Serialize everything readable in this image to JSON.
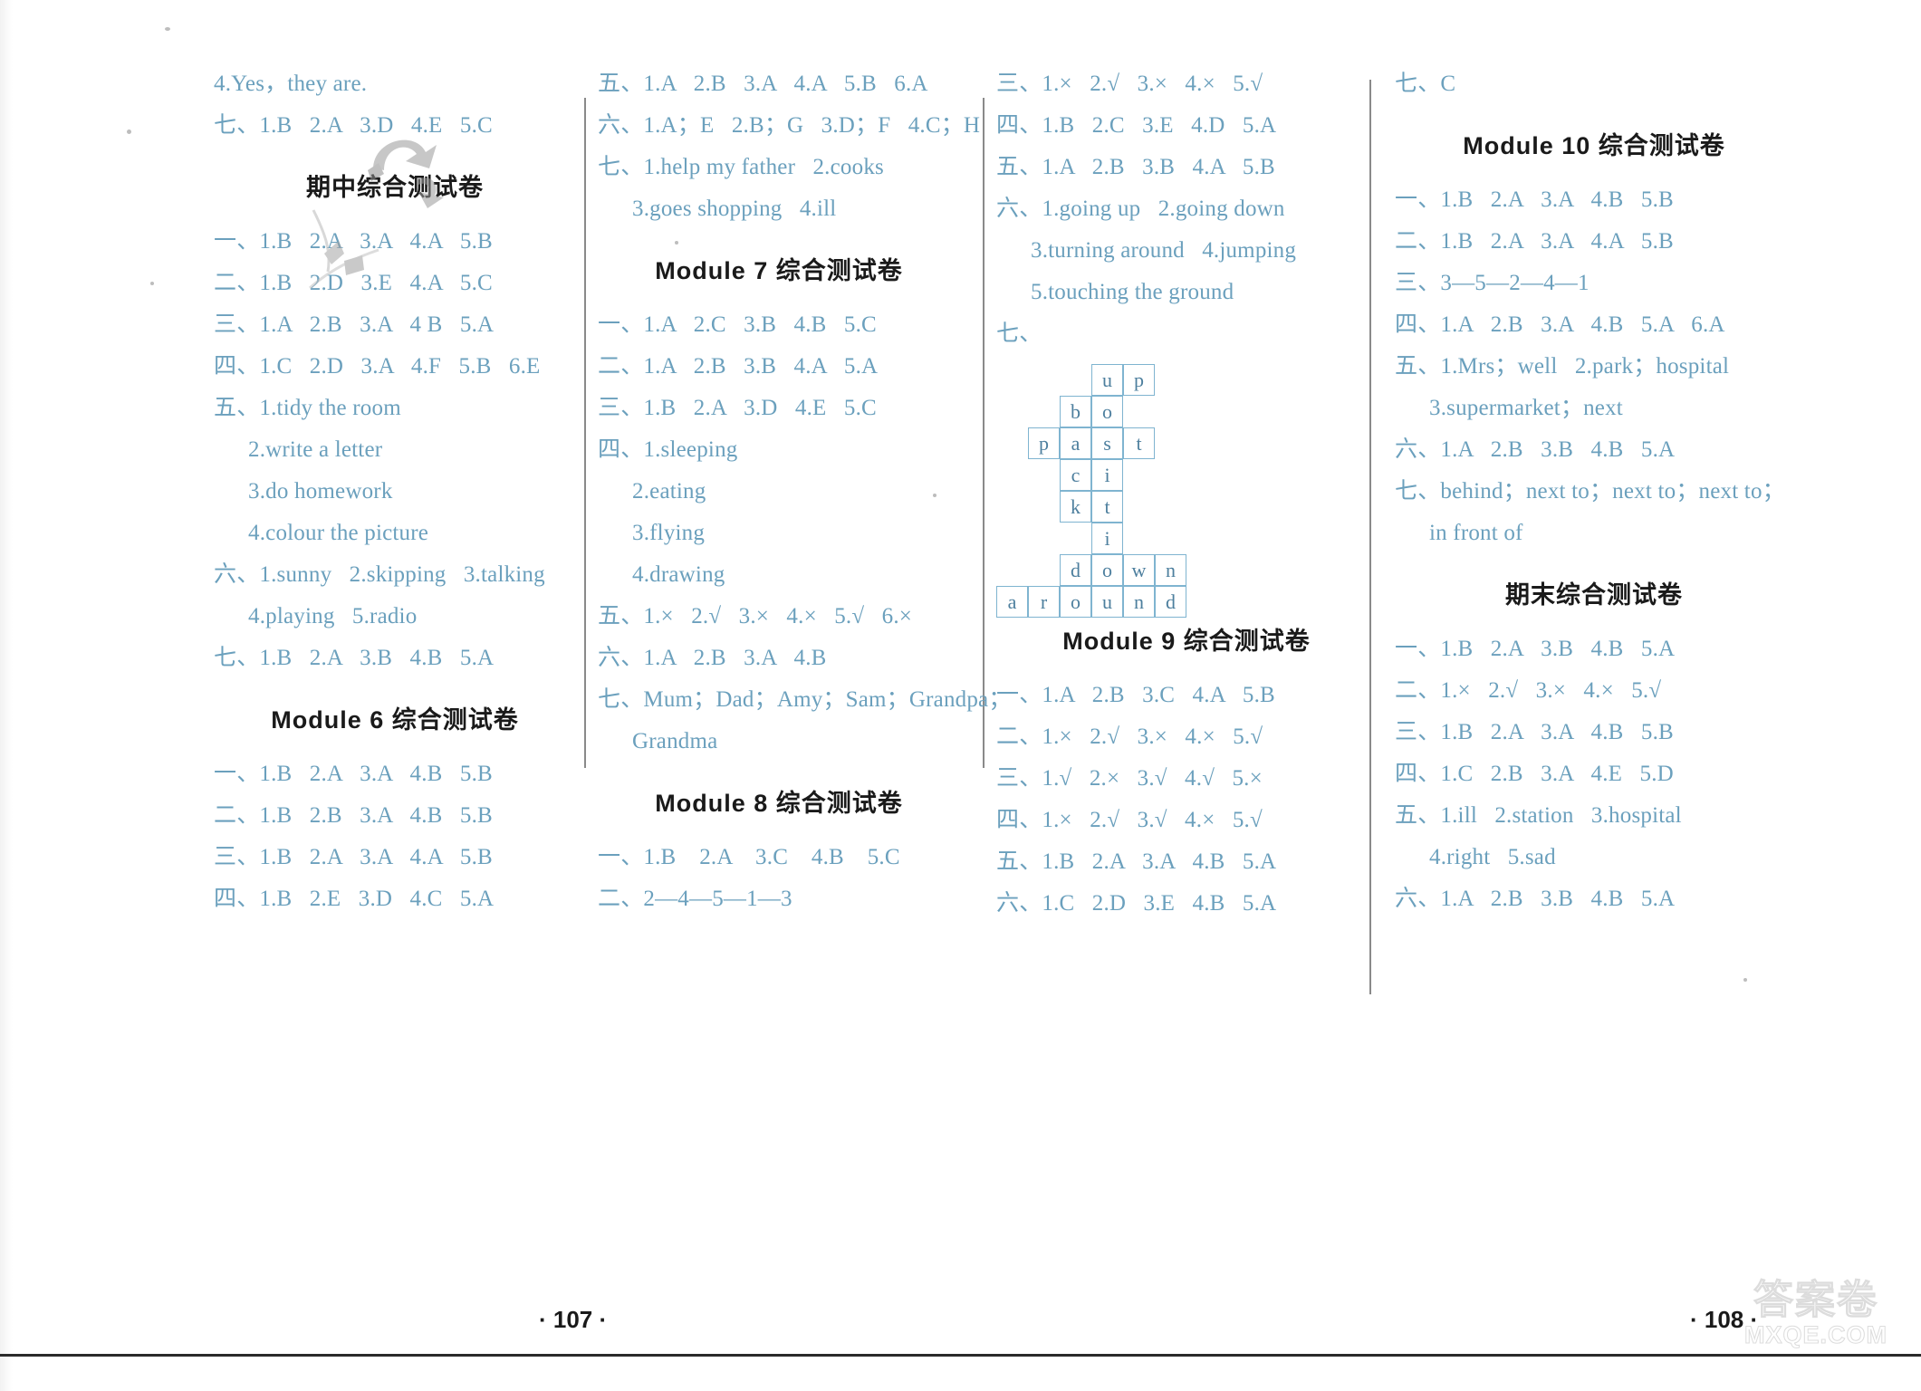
{
  "page": {
    "left_page_number": "· 107 ·",
    "right_page_number": "· 108 ·",
    "watermark_cn": "答案卷",
    "watermark_en": "MXQE.COM"
  },
  "columns": [
    {
      "id": "column-1",
      "blocks": [
        {
          "type": "lines",
          "lines": [
            "4.Yes，they are.",
            "七、1.B   2.A   3.D   4.E   5.C"
          ]
        },
        {
          "type": "title",
          "text": "期中综合测试卷"
        },
        {
          "type": "lines",
          "lines": [
            "一、1.B   2.A   3.A   4.A   5.B",
            "二、1.B   2.D   3.E   4.A   5.C",
            "三、1.A   2.B   3.A   4 B   5.A",
            "四、1.C   2.D   3.A   4.F   5.B   6.E",
            "五、1.tidy the room"
          ]
        },
        {
          "type": "lines-indent",
          "lines": [
            "2.write a letter",
            "3.do homework",
            "4.colour the picture"
          ]
        },
        {
          "type": "lines",
          "lines": [
            "六、1.sunny   2.skipping   3.talking"
          ]
        },
        {
          "type": "lines-indent",
          "lines": [
            "4.playing   5.radio"
          ]
        },
        {
          "type": "lines",
          "lines": [
            "七、1.B   2.A   3.B   4.B   5.A"
          ]
        },
        {
          "type": "title",
          "text": "Module 6 综合测试卷"
        },
        {
          "type": "lines",
          "lines": [
            "一、1.B   2.A   3.A   4.B   5.B",
            "二、1.B   2.B   3.A   4.B   5.B",
            "三、1.B   2.A   3.A   4.A   5.B",
            "四、1.B   2.E   3.D   4.C   5.A"
          ]
        }
      ]
    },
    {
      "id": "column-2",
      "blocks": [
        {
          "type": "lines",
          "lines": [
            "五、1.A   2.B   3.A   4.A   5.B   6.A",
            "六、1.A；E   2.B；G   3.D；F   4.C；H",
            "七、1.help my father   2.cooks"
          ]
        },
        {
          "type": "lines-indent",
          "lines": [
            "3.goes shopping   4.ill"
          ]
        },
        {
          "type": "title",
          "text": "Module 7 综合测试卷"
        },
        {
          "type": "lines",
          "lines": [
            "一、1.A   2.C   3.B   4.B   5.C",
            "二、1.A   2.B   3.B   4.A   5.A",
            "三、1.B   2.A   3.D   4.E   5.C",
            "四、1.sleeping"
          ]
        },
        {
          "type": "lines-indent",
          "lines": [
            "2.eating",
            "3.flying",
            "4.drawing"
          ]
        },
        {
          "type": "lines",
          "lines": [
            "五、1.×   2.√   3.×   4.×   5.√   6.×",
            "六、1.A   2.B   3.A   4.B",
            "七、Mum；Dad；Amy；Sam；Grandpa；"
          ]
        },
        {
          "type": "lines-indent",
          "lines": [
            "Grandma"
          ]
        },
        {
          "type": "title",
          "text": "Module 8 综合测试卷"
        },
        {
          "type": "lines",
          "lines": [
            "一、1.B    2.A    3.C    4.B    5.C",
            "二、2—4—5—1—3"
          ]
        }
      ]
    },
    {
      "id": "column-3",
      "blocks": [
        {
          "type": "lines",
          "lines": [
            "三、1.×   2.√   3.×   4.×   5.√",
            "四、1.B   2.C   3.E   4.D   5.A",
            "五、1.A   2.B   3.B   4.A   5.B",
            "六、1.going up   2.going down"
          ]
        },
        {
          "type": "lines-indent",
          "lines": [
            "3.turning around   4.jumping",
            "5.touching the ground"
          ]
        },
        {
          "type": "lines",
          "lines": [
            "七、"
          ]
        },
        {
          "type": "crossword"
        },
        {
          "type": "title",
          "text": "Module 9 综合测试卷"
        },
        {
          "type": "lines",
          "lines": [
            "一、1.A   2.B   3.C   4.A   5.B",
            "二、1.×   2.√   3.×   4.×   5.√",
            "三、1.√   2.×   3.√   4.√   5.×",
            "四、1.×   2.√   3.√   4.×   5.√",
            "五、1.B   2.A   3.A   4.B   5.A",
            "六、1.C   2.D   3.E   4.B   5.A"
          ]
        }
      ]
    },
    {
      "id": "column-4",
      "blocks": [
        {
          "type": "lines",
          "lines": [
            "七、C"
          ]
        },
        {
          "type": "title",
          "text": "Module 10 综合测试卷"
        },
        {
          "type": "lines",
          "lines": [
            "一、1.B   2.A   3.A   4.B   5.B",
            "二、1.B   2.A   3.A   4.A   5.B",
            "三、3—5—2—4—1",
            "四、1.A   2.B   3.A   4.B   5.A   6.A",
            "五、1.Mrs；well   2.park；hospital"
          ]
        },
        {
          "type": "lines-indent",
          "lines": [
            "3.supermarket；next"
          ]
        },
        {
          "type": "lines",
          "lines": [
            "六、1.A   2.B   3.B   4.B   5.A",
            "七、behind；next to；next to；next to；"
          ]
        },
        {
          "type": "lines-indent",
          "lines": [
            "in front of"
          ]
        },
        {
          "type": "title",
          "text": "期末综合测试卷"
        },
        {
          "type": "lines",
          "lines": [
            "一、1.B   2.A   3.B   4.B   5.A",
            "二、1.×   2.√   3.×   4.×   5.√",
            "三、1.B   2.A   3.A   4.B   5.B",
            "四、1.C   2.B   3.A   4.E   5.D",
            "五、1.ill   2.station   3.hospital"
          ]
        },
        {
          "type": "lines-indent",
          "lines": [
            "4.right   5.sad"
          ]
        },
        {
          "type": "lines",
          "lines": [
            "六、1.A   2.B   3.B   4.B   5.A"
          ]
        }
      ]
    }
  ],
  "crossword": {
    "cell_size": 35,
    "cells": [
      {
        "letter": "u",
        "col": 3,
        "row": 0
      },
      {
        "letter": "p",
        "col": 4,
        "row": 0
      },
      {
        "letter": "b",
        "col": 2,
        "row": 1
      },
      {
        "letter": "o",
        "col": 3,
        "row": 1
      },
      {
        "letter": "p",
        "col": 1,
        "row": 2
      },
      {
        "letter": "a",
        "col": 2,
        "row": 2
      },
      {
        "letter": "s",
        "col": 3,
        "row": 2
      },
      {
        "letter": "t",
        "col": 4,
        "row": 2
      },
      {
        "letter": "c",
        "col": 2,
        "row": 3
      },
      {
        "letter": "i",
        "col": 3,
        "row": 3
      },
      {
        "letter": "k",
        "col": 2,
        "row": 4
      },
      {
        "letter": "t",
        "col": 3,
        "row": 4
      },
      {
        "letter": "i",
        "col": 3,
        "row": 5
      },
      {
        "letter": "d",
        "col": 2,
        "row": 6
      },
      {
        "letter": "o",
        "col": 3,
        "row": 6
      },
      {
        "letter": "w",
        "col": 4,
        "row": 6
      },
      {
        "letter": "n",
        "col": 5,
        "row": 6
      },
      {
        "letter": "a",
        "col": 0,
        "row": 7
      },
      {
        "letter": "r",
        "col": 1,
        "row": 7
      },
      {
        "letter": "o",
        "col": 2,
        "row": 7
      },
      {
        "letter": "u",
        "col": 3,
        "row": 7
      },
      {
        "letter": "n",
        "col": 4,
        "row": 7
      },
      {
        "letter": "d",
        "col": 5,
        "row": 7
      }
    ]
  }
}
